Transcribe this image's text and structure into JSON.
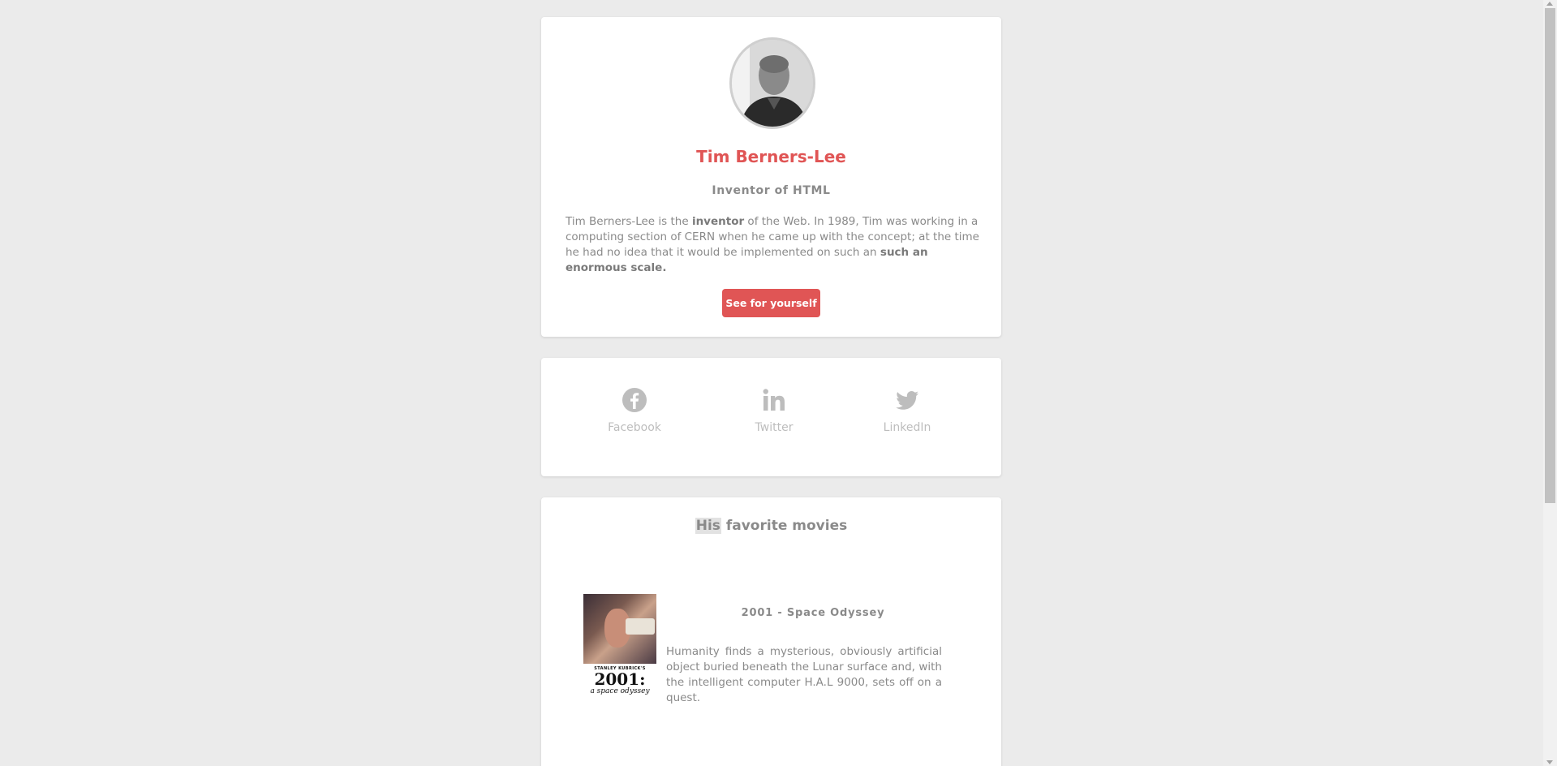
{
  "profile": {
    "name": "Tim Berners-Lee",
    "role": "Inventor of HTML",
    "bio": {
      "t1": "Tim Berners-Lee is the ",
      "b1": "inventor",
      "t2": " of the Web. In 1989, Tim was working in a computing section of CERN when he came up with the concept; at the time he had no idea that it would be implemented on such an ",
      "b2": "such an enormous scale."
    },
    "cta_label": "See for yourself"
  },
  "social": {
    "items": [
      {
        "label": "Facebook",
        "icon": "facebook-icon"
      },
      {
        "label": "Twitter",
        "icon": "linkedin-icon"
      },
      {
        "label": "LinkedIn",
        "icon": "twitter-icon"
      }
    ]
  },
  "movies": {
    "heading_highlight": "His",
    "heading_rest": " favorite movies",
    "items": [
      {
        "title": "2001 - Space Odyssey",
        "description": "Humanity finds a mysterious, obviously artificial object buried beneath the Lunar surface and, with the intelligent computer H.A.L 9000, sets off on a quest.",
        "poster": {
          "credit": "STANLEY KUBRICK'S",
          "big": "2001:",
          "sub": "a space odyssey"
        }
      }
    ]
  },
  "colors": {
    "accent": "#e05555",
    "background": "#ebebeb",
    "card": "#ffffff",
    "text": "#8a8a8a",
    "icon": "#bdbdbd"
  }
}
